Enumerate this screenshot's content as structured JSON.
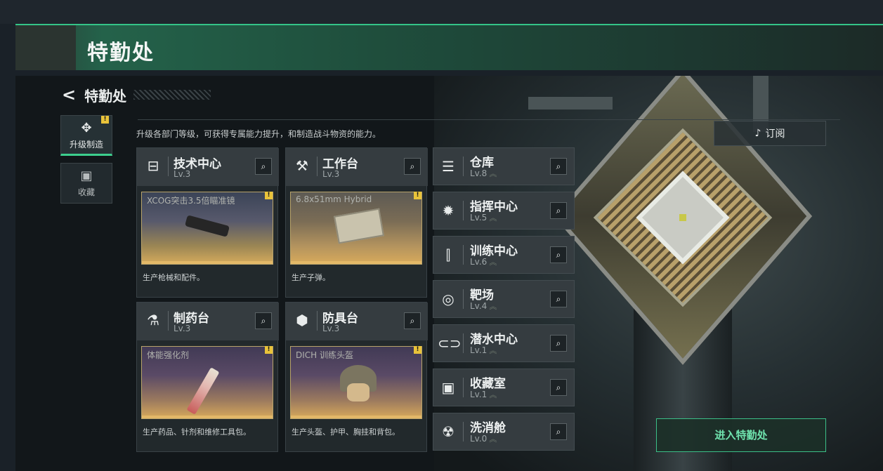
{
  "window": {
    "title": "特勤处"
  },
  "header": {
    "back_title": "特勤处"
  },
  "sidenav": [
    {
      "icon": "upgrade-craft-icon",
      "label": "升级制造",
      "active": true,
      "badge": "!"
    },
    {
      "icon": "collection-icon",
      "label": "收藏",
      "active": false
    }
  ],
  "intro_text": "升级各部门等级，可获得专属能力提升，和制造战斗物资的能力。",
  "subscribe": {
    "label": "订阅"
  },
  "workbenches": [
    {
      "name": "技术中心",
      "level": "Lv.3",
      "icon": "tech-center-icon",
      "item": "XCOG突击3.5倍瞄准镜",
      "desc": "生产枪械和配件。"
    },
    {
      "name": "工作台",
      "level": "Lv.3",
      "icon": "workbench-icon",
      "item": "6.8x51mm Hybrid",
      "desc": "生产子弹。"
    },
    {
      "name": "制药台",
      "level": "Lv.3",
      "icon": "pharmacy-icon",
      "item": "体能强化剂",
      "desc": "生产药品、针剂和维修工具包。"
    },
    {
      "name": "防具台",
      "level": "Lv.3",
      "icon": "armor-bench-icon",
      "item": "DICH 训练头盔",
      "desc": "生产头盔、护甲、胸挂和背包。"
    }
  ],
  "facilities": [
    {
      "name": "仓库",
      "level": "Lv.8",
      "icon": "warehouse-icon"
    },
    {
      "name": "指挥中心",
      "level": "Lv.5",
      "icon": "command-center-icon"
    },
    {
      "name": "训练中心",
      "level": "Lv.6",
      "icon": "training-center-icon"
    },
    {
      "name": "靶场",
      "level": "Lv.4",
      "icon": "shooting-range-icon"
    },
    {
      "name": "潜水中心",
      "level": "Lv.1",
      "icon": "diving-center-icon"
    },
    {
      "name": "收藏室",
      "level": "Lv.1",
      "icon": "collection-room-icon"
    },
    {
      "name": "洗消舱",
      "level": "Lv.0",
      "icon": "decon-pod-icon"
    }
  ],
  "enter_button": {
    "label": "进入特勤处"
  },
  "colors": {
    "accent": "#3bbf88",
    "badge": "#e9c33a",
    "thumb_bar": "#e3b868"
  }
}
